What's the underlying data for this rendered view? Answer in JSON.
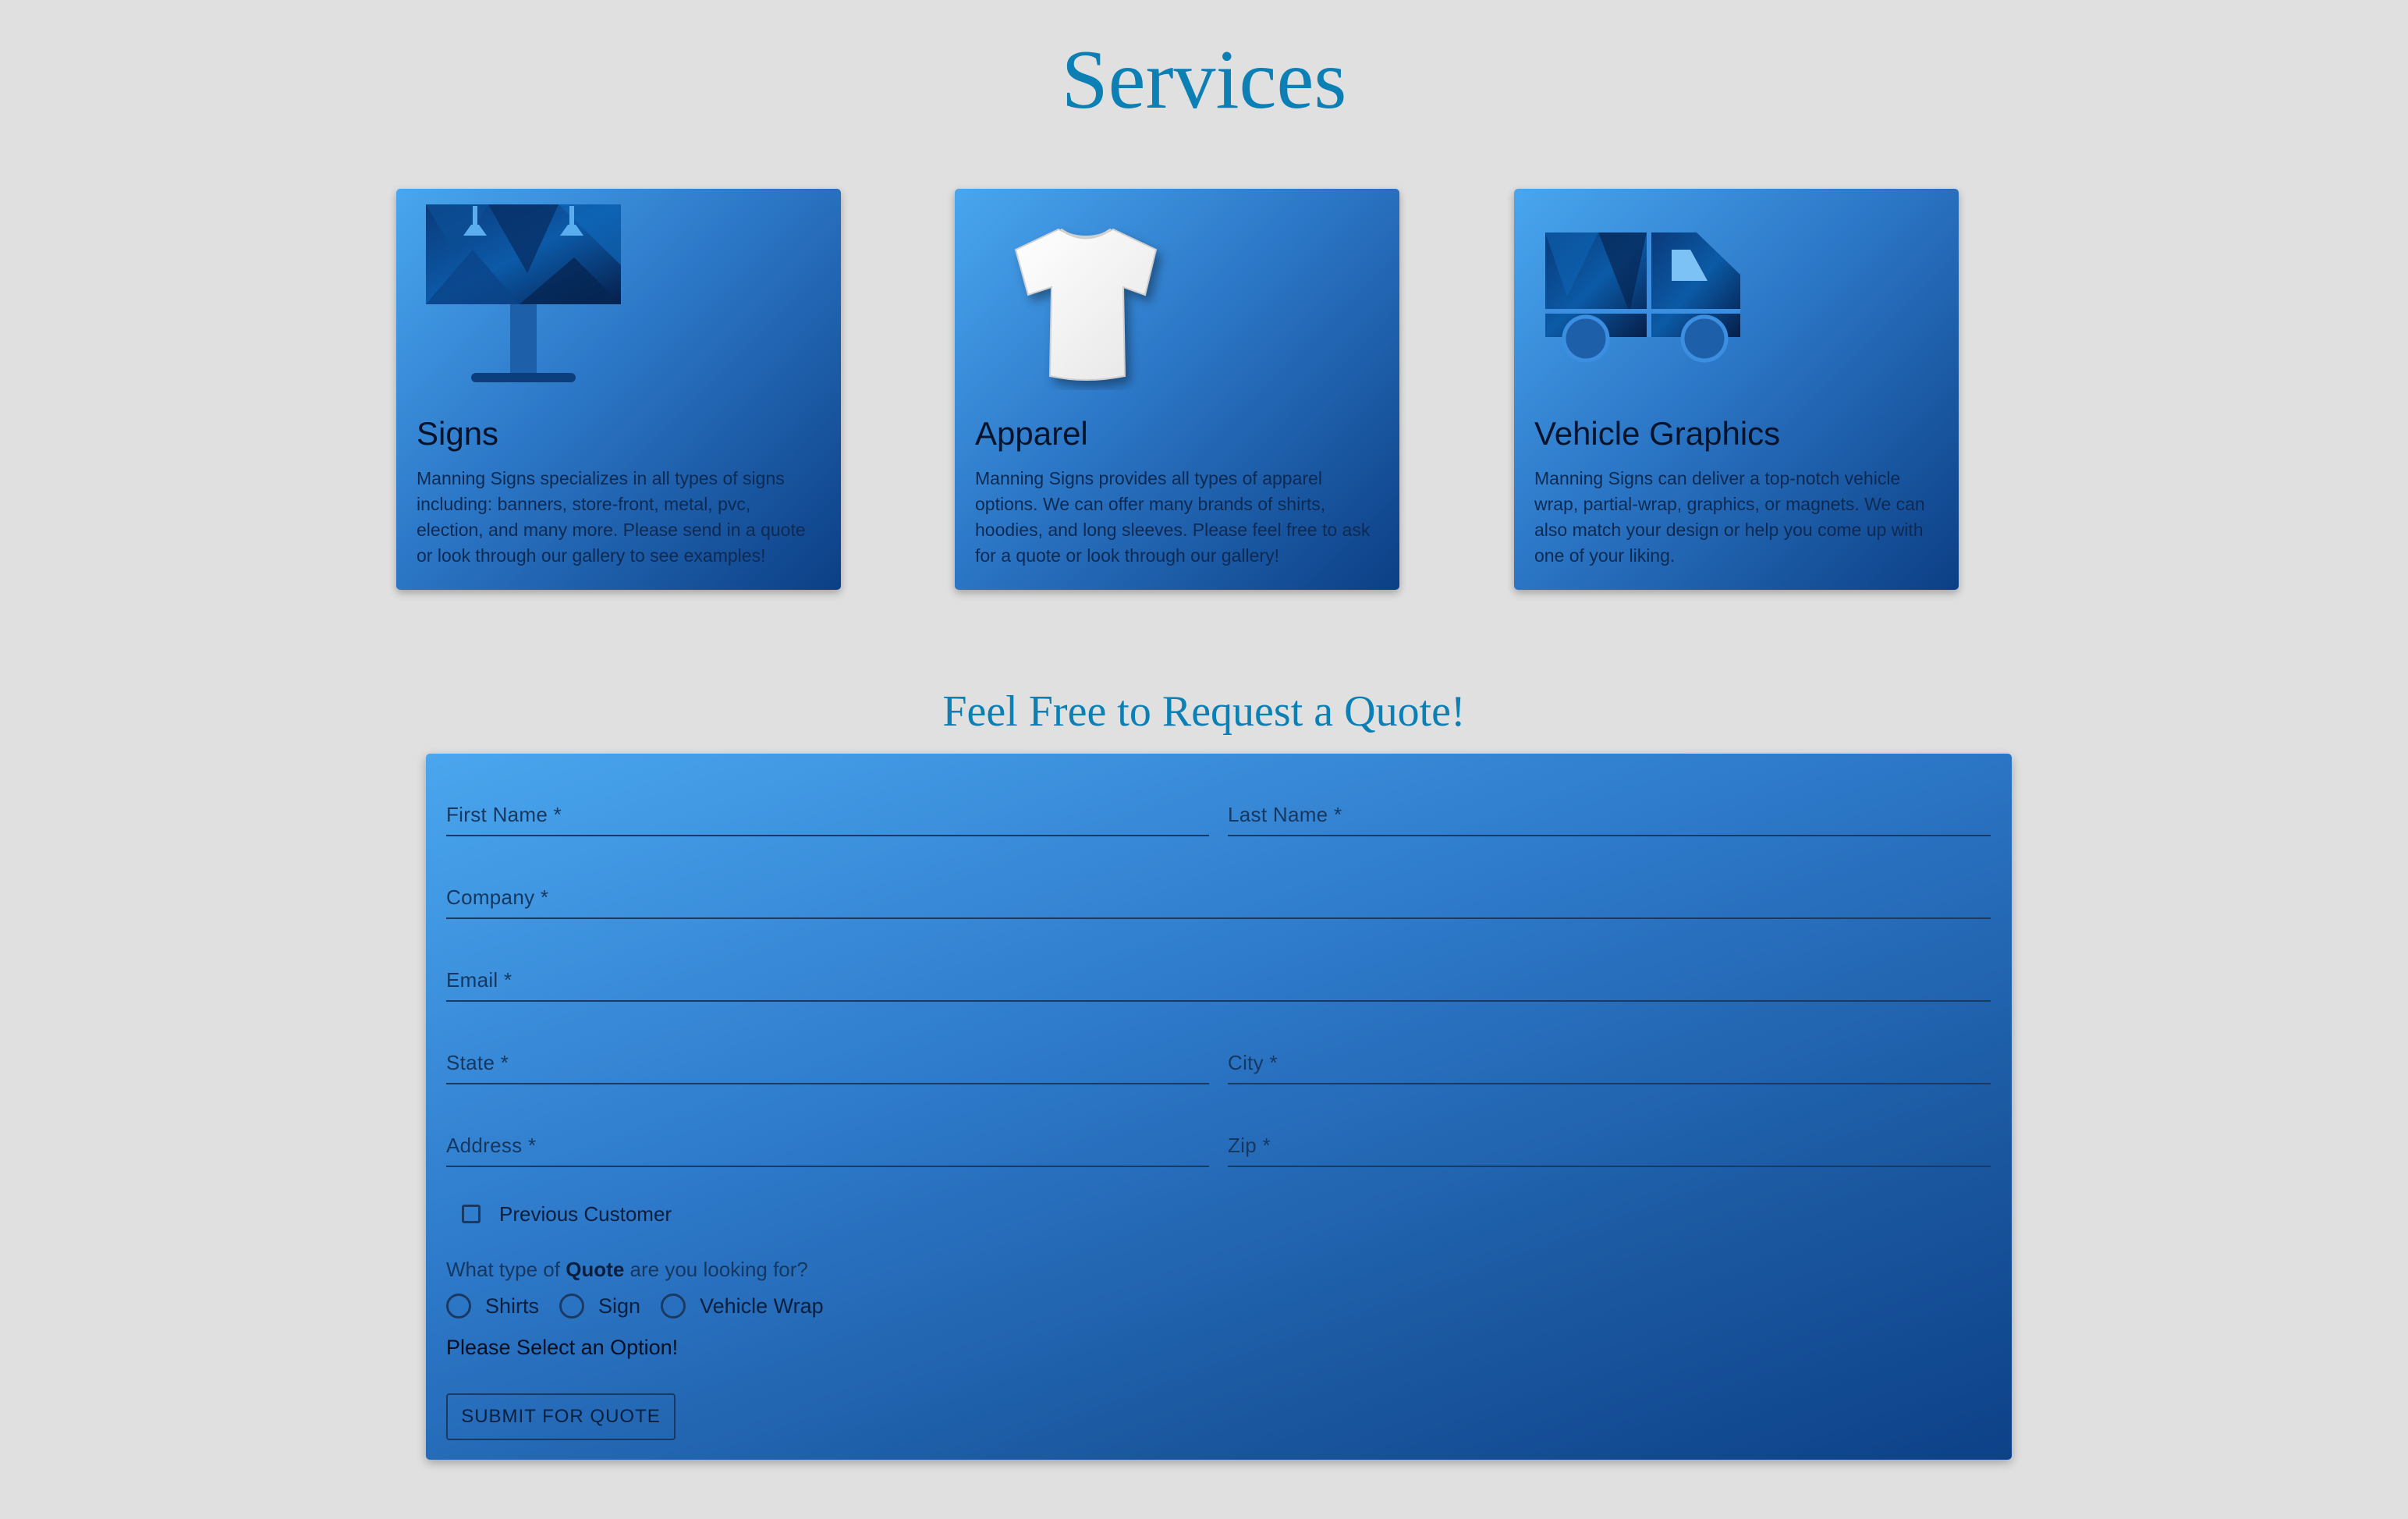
{
  "page": {
    "title": "Services",
    "quote_title": "Feel Free to Request a Quote!"
  },
  "services": [
    {
      "title": "Signs",
      "icon": "billboard-icon",
      "description": "Manning Signs specializes in all types of signs including: banners, store-front, metal, pvc, election, and many more. Please send in a quote or look through our gallery to see examples!"
    },
    {
      "title": "Apparel",
      "icon": "tshirt-icon",
      "description": "Manning Signs provides all types of apparel options. We can offer many brands of shirts, hoodies, and long sleeves. Please feel free to ask for a quote or look through our gallery!"
    },
    {
      "title": "Vehicle Graphics",
      "icon": "truck-icon",
      "description": "Manning Signs can deliver a top-notch vehicle wrap, partial-wrap, graphics, or magnets. We can also match your design or help you come up with one of your liking."
    }
  ],
  "form": {
    "first_name": {
      "label": "First Name *",
      "value": ""
    },
    "last_name": {
      "label": "Last Name *",
      "value": ""
    },
    "company": {
      "label": "Company *",
      "value": ""
    },
    "email": {
      "label": "Email *",
      "value": ""
    },
    "state": {
      "label": "State *",
      "value": ""
    },
    "city": {
      "label": "City *",
      "value": ""
    },
    "address": {
      "label": "Address *",
      "value": ""
    },
    "zip": {
      "label": "Zip *",
      "value": ""
    },
    "previous_customer": {
      "label": "Previous Customer",
      "checked": false
    },
    "quote_question": {
      "prefix": "What type of ",
      "bold": "Quote",
      "suffix": " are you looking for?"
    },
    "quote_options": [
      "Shirts",
      "Sign",
      "Vehicle Wrap"
    ],
    "validation_message": "Please Select an Option!",
    "submit_label": "SUBMIT FOR QUOTE"
  }
}
